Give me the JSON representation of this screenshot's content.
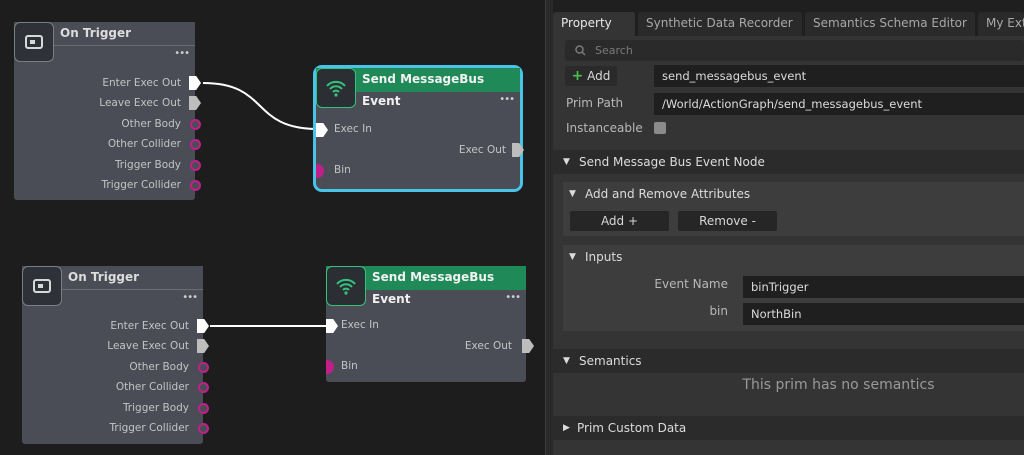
{
  "graph": {
    "nodes": [
      {
        "title": "On Trigger",
        "outputs": [
          "Enter Exec Out",
          "Leave Exec Out",
          "Other Body",
          "Other Collider",
          "Trigger Body",
          "Trigger Collider"
        ]
      },
      {
        "title": "Send MessageBus Event",
        "inputs": [
          "Exec In",
          "Bin"
        ],
        "outputs": [
          "Exec Out"
        ]
      },
      {
        "title": "On Trigger",
        "outputs": [
          "Enter Exec Out",
          "Leave Exec Out",
          "Other Body",
          "Other Collider",
          "Trigger Body",
          "Trigger Collider"
        ]
      },
      {
        "title": "Send MessageBus Event",
        "inputs": [
          "Exec In",
          "Bin"
        ],
        "outputs": [
          "Exec Out"
        ]
      }
    ],
    "menu_dots": "•••"
  },
  "panel": {
    "tabs": [
      "Property",
      "Synthetic Data Recorder",
      "Semantics Schema Editor",
      "My Ext"
    ],
    "search_placeholder": "Search",
    "add_label": "Add",
    "name_value": "send_messagebus_event",
    "prim_path_label": "Prim Path",
    "prim_path_value": "/World/ActionGraph/send_messagebus_event",
    "instanceable_label": "Instanceable",
    "sections": {
      "node": "Send Message Bus Event Node",
      "add_remove": "Add and Remove Attributes",
      "add_btn": "Add +",
      "remove_btn": "Remove -",
      "inputs": "Inputs",
      "event_name_label": "Event Name",
      "event_name_value": "binTrigger",
      "bin_label": "bin",
      "bin_value": "NorthBin",
      "semantics": "Semantics",
      "no_semantics": "This prim has no semantics",
      "custom_data": "Prim Custom Data"
    }
  },
  "colors": {
    "send_header": "#1f8a58",
    "selection": "#4ac3e8",
    "bin_port": "#c01f8a"
  }
}
